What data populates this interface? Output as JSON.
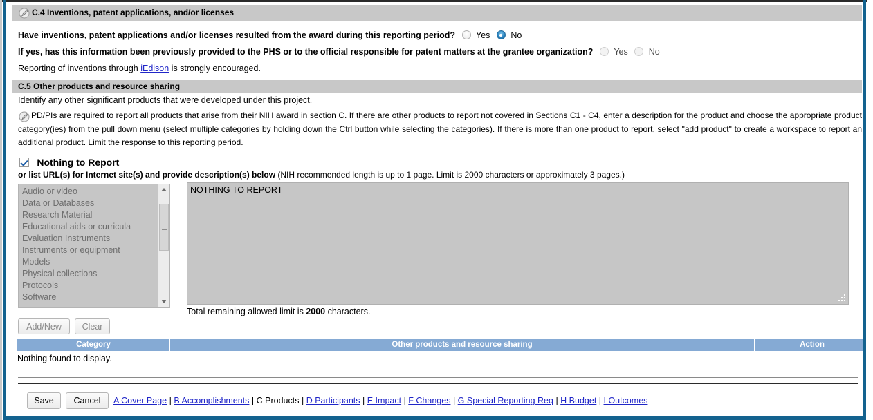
{
  "sections": {
    "c4": {
      "icon": "quill-pencil-icon",
      "title": "C.4 Inventions, patent applications, and/or licenses",
      "question1": {
        "text": "Have inventions, patent applications and/or licenses resulted from the award during this reporting period?",
        "options": [
          "Yes",
          "No"
        ],
        "selected": "No",
        "disabled": false
      },
      "question2": {
        "text": "If yes, has this information been previously provided to the PHS or to the official responsible for patent matters at the grantee organization?",
        "options": [
          "Yes",
          "No"
        ],
        "selected": "",
        "disabled": true
      },
      "note_before": "Reporting of inventions through ",
      "note_link": "iEdison",
      "note_after": " is strongly encouraged."
    },
    "c5": {
      "title": "C.5 Other products and resource sharing",
      "subtitle": "Identify any other significant products that were developed under this project.",
      "icon": "quill-pencil-icon",
      "instructions": "PD/PIs are required to report all products that arise from their NIH award in section C. If there are other products to report not covered in Sections C1 - C4, enter a description for the product and choose the appropriate product category(ies) from the pull down menu (select multiple categories by holding down the Ctrl button while selecting the categories). If there is more than one product to report, select \"add product\" to create a workspace to report an additional product. Limit the response to this reporting period.",
      "nothing_to_report": {
        "label": "Nothing to Report",
        "checked": true
      },
      "url_line_bold": "or list URL(s) for Internet site(s) and provide description(s) below",
      "url_line_normal": " (NIH recommended length is up to 1 page. Limit is 2000 characters or approximately 3 pages.)",
      "category_list": {
        "disabled": true,
        "options": [
          "Audio or video",
          "Data or Databases",
          "Research Material",
          "Educational aids or curricula",
          "Evaluation Instruments",
          "Instruments or equipment",
          "Models",
          "Physical collections",
          "Protocols",
          "Software"
        ]
      },
      "description": {
        "value": "NOTHING TO REPORT",
        "placeholder": "",
        "disabled": true
      },
      "limit_prefix": "Total remaining allowed limit is ",
      "limit_value": "2000",
      "limit_suffix": " characters.",
      "buttons": {
        "add_new": "Add/New",
        "clear": "Clear"
      },
      "table": {
        "headers": [
          "Category",
          "Other products and resource sharing",
          "Action"
        ],
        "empty_message": "Nothing found to display.",
        "rows": []
      }
    }
  },
  "footer": {
    "save_label": "Save",
    "cancel_label": "Cancel",
    "nav": [
      {
        "label": "A Cover Page",
        "current": false
      },
      {
        "label": "B Accomplishments",
        "current": false
      },
      {
        "label": "C Products",
        "current": true
      },
      {
        "label": "D Participants",
        "current": false
      },
      {
        "label": "E Impact",
        "current": false
      },
      {
        "label": "F Changes",
        "current": false
      },
      {
        "label": "G Special Reporting Req",
        "current": false
      },
      {
        "label": "H Budget",
        "current": false
      },
      {
        "label": "I Outcomes",
        "current": false
      }
    ],
    "separator": "|"
  },
  "colors": {
    "frame_blue": "#13628f",
    "section_header_gray": "#c8c8c8",
    "table_header_blue": "#85aad4",
    "link_blue": "#2026c8",
    "disabled_field_gray": "#c6c6c6"
  }
}
